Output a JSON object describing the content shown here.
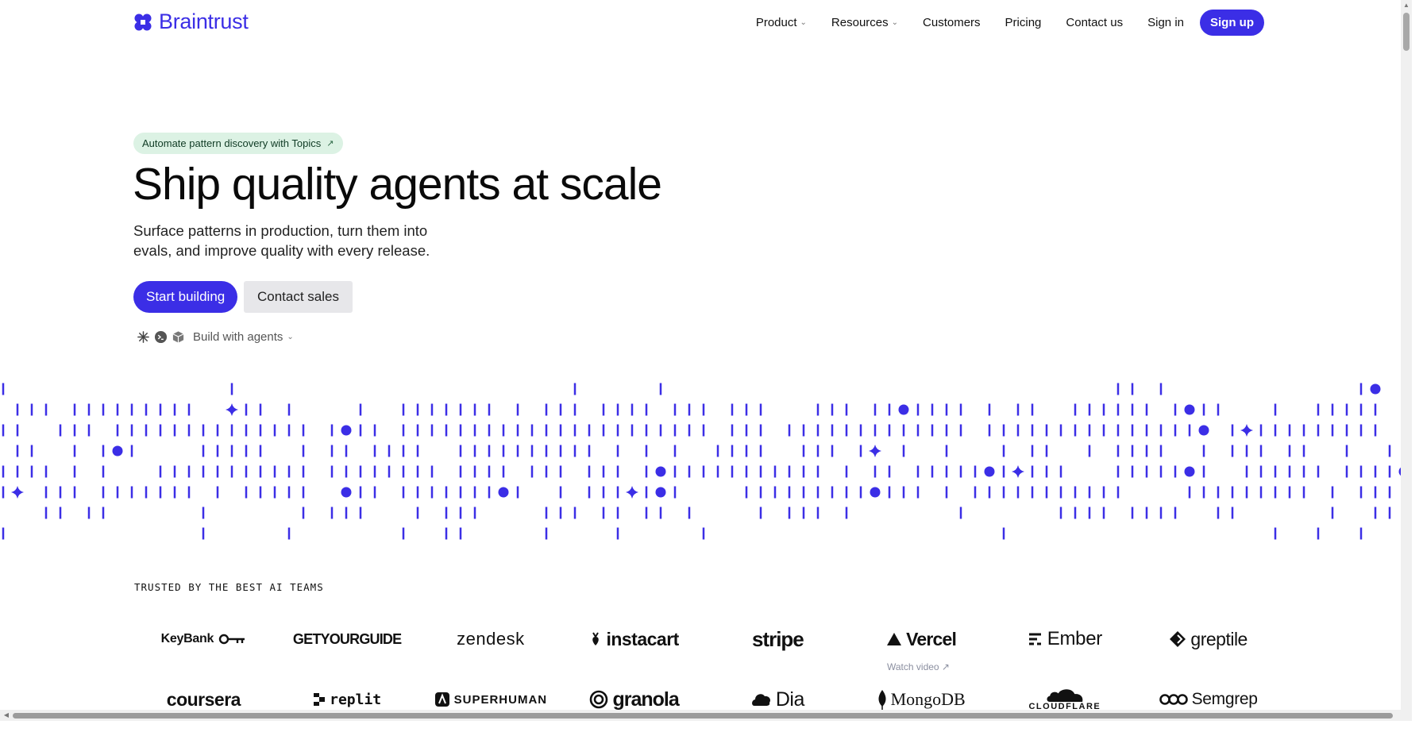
{
  "brand": {
    "name": "Braintrust",
    "color": "#3b2ee6",
    "logo_icon": "clover-logo-icon"
  },
  "nav": {
    "items": [
      {
        "label": "Product",
        "has_dropdown": true
      },
      {
        "label": "Resources",
        "has_dropdown": true
      },
      {
        "label": "Customers",
        "has_dropdown": false
      },
      {
        "label": "Pricing",
        "has_dropdown": false
      },
      {
        "label": "Contact us",
        "has_dropdown": false
      },
      {
        "label": "Sign in",
        "has_dropdown": false
      }
    ],
    "signup_label": "Sign up"
  },
  "hero": {
    "announcement": "Automate pattern discovery with Topics",
    "announcement_arrow": "↗",
    "headline": "Ship quality agents at scale",
    "subheadline": "Surface patterns in production, turn them into evals, and improve quality with every release.",
    "primary_cta": "Start building",
    "secondary_cta": "Contact sales",
    "agents_label": "Build with agents",
    "agents_icons": [
      "claude-icon",
      "terminal-icon",
      "cube-icon"
    ]
  },
  "trusted": {
    "heading": "TRUSTED BY THE BEST AI TEAMS",
    "logos_row1": [
      "KeyBank",
      "GETYOURGUIDE",
      "zendesk",
      "instacart",
      "stripe",
      "Vercel",
      "Ember",
      "greptile"
    ],
    "watch_video": "Watch video ↗",
    "logos_row2": [
      "coursera",
      "replit",
      "SUPERHUMAN",
      "granola",
      "Dia",
      "MongoDB",
      "CLOUDFLARE",
      "Semgrep"
    ]
  },
  "colors": {
    "accent": "#3b2ee6",
    "pill_bg": "#dcf2e4",
    "secondary_btn_bg": "#e7e7ea"
  }
}
